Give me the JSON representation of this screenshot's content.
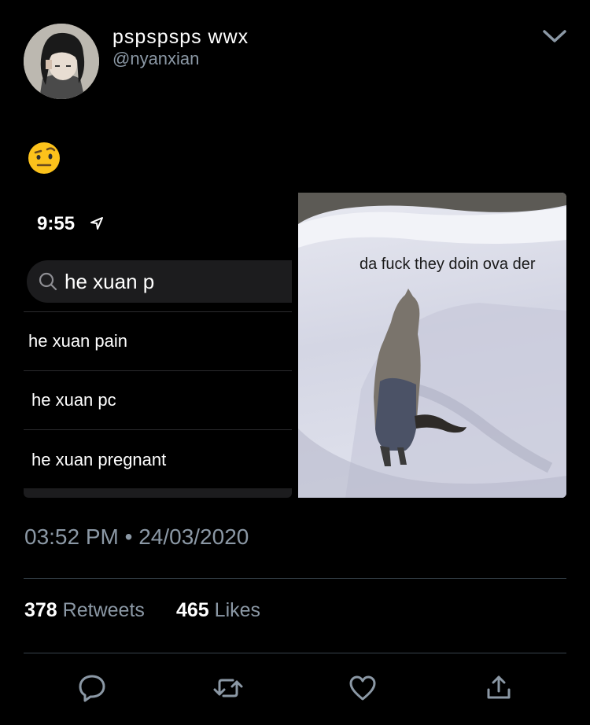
{
  "tweet": {
    "display_name": "pspspsps wwx",
    "handle": "@nyanxian",
    "emoji": "🤨",
    "timestamp": "03:52 PM • 24/03/2020",
    "retweets_count": "378",
    "retweets_label": "Retweets",
    "likes_count": "465",
    "likes_label": "Likes"
  },
  "phone_screenshot": {
    "time": "9:55",
    "search_query": "he xuan p",
    "suggestions": [
      "he xuan pain",
      "he xuan pc",
      "he xuan pregnant"
    ]
  },
  "meme": {
    "caption": "da fuck they doin ova der"
  },
  "actions": {
    "reply": "reply-icon",
    "retweet": "retweet-icon",
    "like": "heart-icon",
    "share": "share-icon"
  },
  "colors": {
    "background": "#000000",
    "secondary_text": "#8b98a5",
    "divider": "#38444d"
  }
}
